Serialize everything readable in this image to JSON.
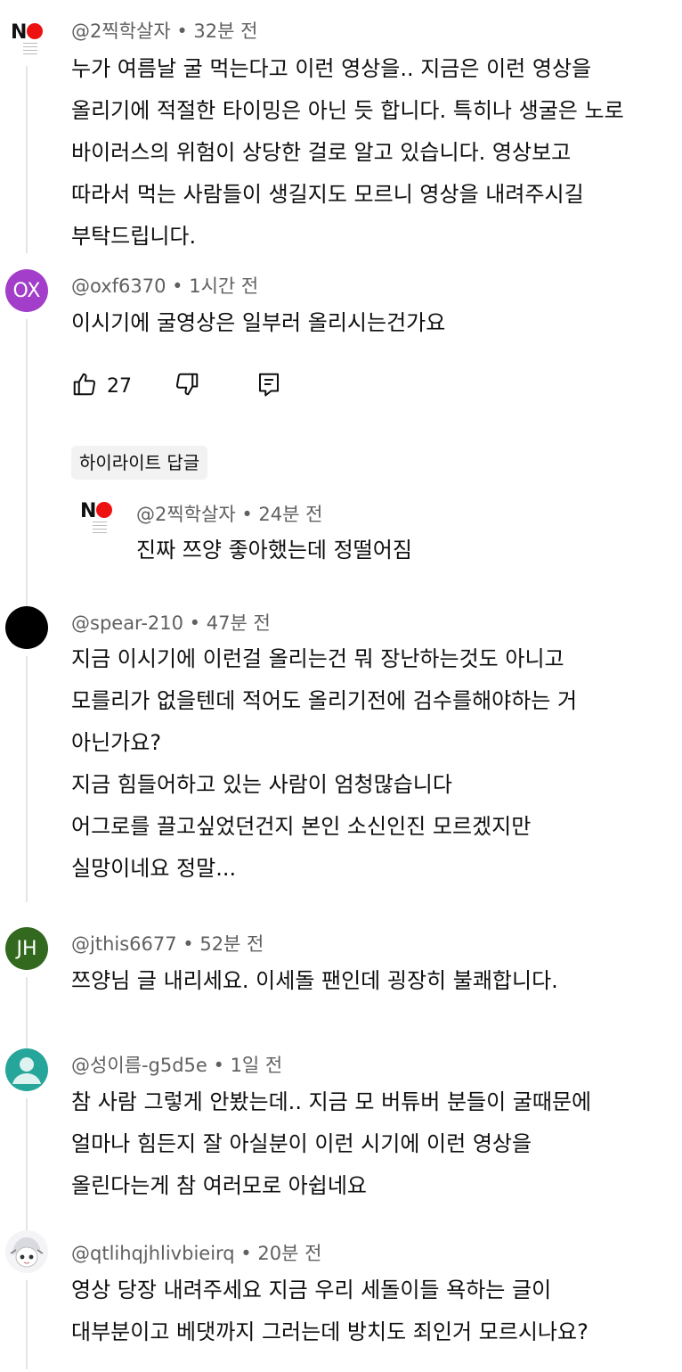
{
  "comments": [
    {
      "author": "@2찍학살자",
      "time": "32분 전",
      "avatar_type": "no-logo",
      "avatar_text": "NO",
      "text": "누가 여름날 굴 먹는다고 이런 영상을.. 지금은 이런 영상을\n올리기에 적절한 타이밍은 아닌 듯 합니다. 특히나 생굴은 노로\n바이러스의 위험이 상당한 걸로 알고 있습니다. 영상보고\n따라서 먹는 사람들이 생길지도 모르니 영상을 내려주시길\n부탁드립니다."
    },
    {
      "author": "@oxf6370",
      "time": "1시간 전",
      "avatar_text": "OX",
      "avatar_color": "#a23ec9",
      "text": "이시기에 굴영상은 일부러 올리시는건가요",
      "like_count": "27",
      "icons": {
        "like": "thumbs-up-icon",
        "dislike": "thumbs-down-icon",
        "reply": "reply-icon"
      },
      "highlight_chip": "하이라이트 답글",
      "reply": {
        "author": "@2찍학살자",
        "time": "24분 전",
        "avatar_text": "NO",
        "text": "진짜 쯔양 좋아했는데 정떨어짐"
      }
    },
    {
      "author": "@spear-210",
      "time": "47분 전",
      "avatar_color": "#000000",
      "text": "지금 이시기에 이런걸 올리는건 뭐 장난하는것도 아니고\n모를리가 없을텐데 적어도 올리기전에 검수를해야하는 거\n아닌가요?\n지금 힘들어하고 있는 사람이 엄청많습니다\n어그로를 끌고싶었던건지 본인 소신인진 모르겠지만\n실망이네요 정말..."
    },
    {
      "author": "@jthis6677",
      "time": "52분 전",
      "avatar_text": "JH",
      "avatar_color": "#33691e",
      "text": "쯔양님 글 내리세요. 이세돌 팬인데 굉장히 불쾌합니다."
    },
    {
      "author": "@성이름-g5d5e",
      "time": "1일 전",
      "avatar_type": "default-person",
      "avatar_color": "#26a69a",
      "text": "참 사람 그렇게 안봤는데.. 지금 모 버튜버 분들이 굴때문에\n얼마나 힘든지 잘 아실분이 이런 시기에 이런 영상을\n올린다는게 참 여러모로 아쉽네요"
    },
    {
      "author": "@qtlihqjhlivbieirq",
      "time": "20분 전",
      "avatar_type": "anime-drawing",
      "text": "영상 당장 내려주세요 지금 우리 세돌이들 욕하는 글이\n대부분이고 베댓까지 그러는데 방치도 죄인거 모르시나요?"
    }
  ],
  "separator": " • "
}
